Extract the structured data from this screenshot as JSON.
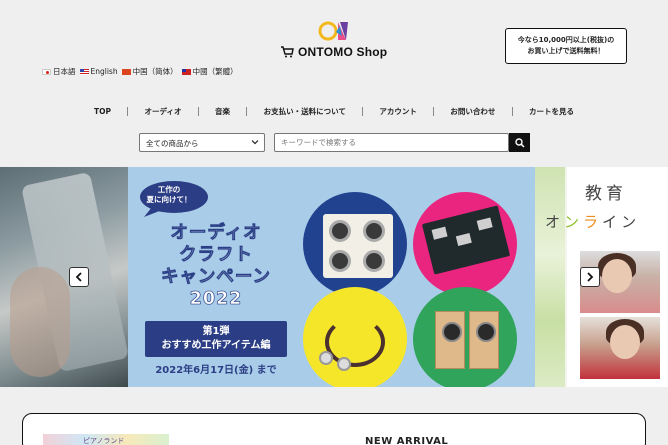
{
  "header": {
    "logo_text": "ONTOMO Shop",
    "shipping_notice_line1": "今なら10,000円以上(税抜)の",
    "shipping_notice_line2": "お買い上げで送料無料！"
  },
  "languages": [
    {
      "label": "日本語",
      "flag": "jp"
    },
    {
      "label": "English",
      "flag": "us"
    },
    {
      "label": "中国（简体）",
      "flag": "cn"
    },
    {
      "label": "中國（繁體）",
      "flag": "tw"
    }
  ],
  "nav": [
    "TOP",
    "オーディオ",
    "音楽",
    "お支払い・送料について",
    "アカウント",
    "お問い合わせ",
    "カートを見る"
  ],
  "search": {
    "category_selected": "全ての商品から",
    "placeholder": "キーワードで検索する"
  },
  "carousel": {
    "main": {
      "bubble_line1": "工作の",
      "bubble_line2": "夏に向けて！",
      "title_line1": "オーディオ",
      "title_line2": "クラフト",
      "title_line3": "キャンペーン",
      "title_line4": "2022",
      "phase_line1": "第1弾",
      "phase_line2": "おすすめ工作アイテム編",
      "deadline": "2022年6月17日(金) まで"
    },
    "right": {
      "title": "教育",
      "subtitle_chars": [
        "オ",
        "ン",
        "ラ",
        "イ",
        "ン"
      ]
    },
    "prev_icon": "chevron-left-icon",
    "next_icon": "chevron-right-icon"
  },
  "bottom": {
    "thumb_text": "ピアノランド",
    "section_title": "NEW ARRIVAL"
  },
  "colors": {
    "campaign_blue": "#2b3d84",
    "banner_bg": "#a9cde9",
    "circle_pink": "#ea2580",
    "circle_yellow": "#f6e629",
    "circle_green": "#2fa45a"
  }
}
